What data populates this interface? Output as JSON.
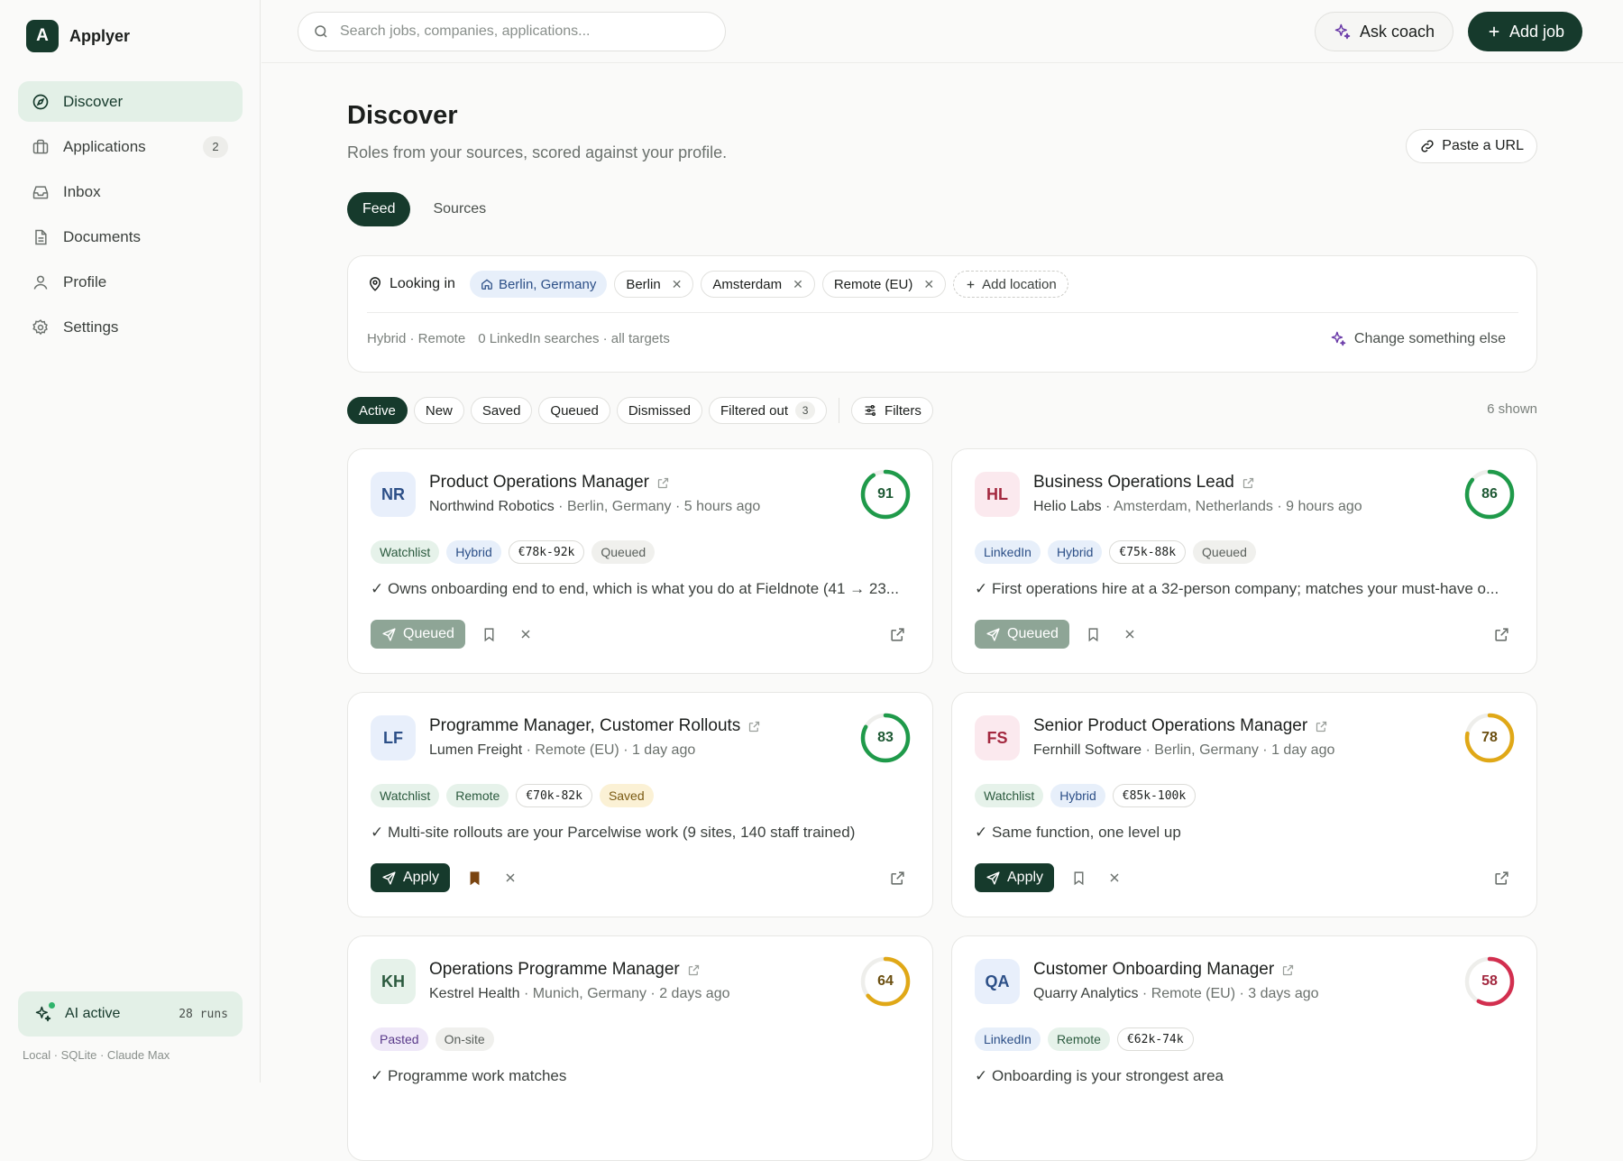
{
  "app": {
    "logo_letter": "A",
    "name": "Applyer"
  },
  "nav": [
    {
      "label": "Discover",
      "icon": "compass-icon",
      "active": true,
      "count": ""
    },
    {
      "label": "Applications",
      "icon": "briefcase-icon",
      "active": false,
      "count": "2"
    },
    {
      "label": "Inbox",
      "icon": "inbox-icon",
      "active": false,
      "count": ""
    },
    {
      "label": "Documents",
      "icon": "document-icon",
      "active": false,
      "count": ""
    },
    {
      "label": "Profile",
      "icon": "user-icon",
      "active": false,
      "count": ""
    },
    {
      "label": "Settings",
      "icon": "gear-icon",
      "active": false,
      "count": ""
    }
  ],
  "ai": {
    "label": "AI active",
    "runs": "28 runs"
  },
  "footer": "Local · SQLite · Claude Max",
  "topbar": {
    "search_placeholder": "Search jobs, companies, applications...",
    "coach_label": "Ask coach",
    "add_label": "Add job"
  },
  "page": {
    "title": "Discover",
    "subtitle": "Roles from your sources, scored against your profile.",
    "paste_label": "Paste a URL"
  },
  "tabs": [
    {
      "label": "Feed",
      "active": true
    },
    {
      "label": "Sources",
      "active": false
    }
  ],
  "locations": {
    "lead": "Looking in",
    "home": "Berlin, Germany",
    "items": [
      "Berlin",
      "Amsterdam",
      "Remote (EU)"
    ],
    "add_label": "Add location",
    "meta_work": "Hybrid · Remote",
    "meta_search": "0 LinkedIn searches · all targets",
    "change_label": "Change something else"
  },
  "filters": {
    "pills": [
      {
        "label": "Active",
        "active": true,
        "count": ""
      },
      {
        "label": "New",
        "active": false,
        "count": ""
      },
      {
        "label": "Saved",
        "active": false,
        "count": ""
      },
      {
        "label": "Queued",
        "active": false,
        "count": ""
      },
      {
        "label": "Dismissed",
        "active": false,
        "count": ""
      },
      {
        "label": "Filtered out",
        "active": false,
        "count": "3"
      }
    ],
    "filters_label": "Filters",
    "shown": "6 shown"
  },
  "colors": {
    "accent": "#163a2c",
    "score_high": "#1f9a4a",
    "score_mid": "#e0a817",
    "score_low": "#d22f4f"
  },
  "jobs": [
    {
      "initials": "NR",
      "av_bg": "#e8effb",
      "av_fg": "#2c4f87",
      "title": "Product Operations Manager",
      "company": "Northwind Robotics",
      "meta": " · Berlin, Germany · 5 hours ago",
      "score": 91,
      "score_color": "#1f9a4a",
      "tags": [
        {
          "text": "Watchlist",
          "style": "green"
        },
        {
          "text": "Hybrid",
          "style": "blue"
        },
        {
          "text": "€78k-92k",
          "style": "money"
        },
        {
          "text": "Queued",
          "style": "grey"
        }
      ],
      "reason": "✓ Owns onboarding end to end, which is what you do at Fieldnote (41 → 23...",
      "action": "Queued",
      "action_style": "queued",
      "saved": false
    },
    {
      "initials": "HL",
      "av_bg": "#fbe9ee",
      "av_fg": "#a3283f",
      "title": "Business Operations Lead",
      "company": "Helio Labs",
      "meta": " · Amsterdam, Netherlands · 9 hours ago",
      "score": 86,
      "score_color": "#1f9a4a",
      "tags": [
        {
          "text": "LinkedIn",
          "style": "blue"
        },
        {
          "text": "Hybrid",
          "style": "blue"
        },
        {
          "text": "€75k-88k",
          "style": "money"
        },
        {
          "text": "Queued",
          "style": "grey"
        }
      ],
      "reason": "✓ First operations hire at a 32-person company; matches your must-have o...",
      "action": "Queued",
      "action_style": "queued",
      "saved": false
    },
    {
      "initials": "LF",
      "av_bg": "#e8effb",
      "av_fg": "#2c4f87",
      "title": "Programme Manager, Customer Rollouts",
      "company": "Lumen Freight",
      "meta": " · Remote (EU) · 1 day ago",
      "score": 83,
      "score_color": "#1f9a4a",
      "tags": [
        {
          "text": "Watchlist",
          "style": "green"
        },
        {
          "text": "Remote",
          "style": "green"
        },
        {
          "text": "€70k-82k",
          "style": "money"
        },
        {
          "text": "Saved",
          "style": "yellow"
        }
      ],
      "reason": "✓ Multi-site rollouts are your Parcelwise work (9 sites, 140 staff trained)",
      "action": "Apply",
      "action_style": "apply",
      "saved": true
    },
    {
      "initials": "FS",
      "av_bg": "#fbe9ee",
      "av_fg": "#a3283f",
      "title": "Senior Product Operations Manager",
      "company": "Fernhill Software",
      "meta": " · Berlin, Germany · 1 day ago",
      "score": 78,
      "score_color": "#e0a817",
      "tags": [
        {
          "text": "Watchlist",
          "style": "green"
        },
        {
          "text": "Hybrid",
          "style": "blue"
        },
        {
          "text": "€85k-100k",
          "style": "money"
        }
      ],
      "reason": "✓ Same function, one level up",
      "action": "Apply",
      "action_style": "apply",
      "saved": false
    },
    {
      "initials": "KH",
      "av_bg": "#e6f2ea",
      "av_fg": "#2b5a3e",
      "title": "Operations Programme Manager",
      "company": "Kestrel Health",
      "meta": " · Munich, Germany · 2 days ago",
      "score": 64,
      "score_color": "#e0a817",
      "tags": [
        {
          "text": "Pasted",
          "style": "purple"
        },
        {
          "text": "On-site",
          "style": "grey"
        }
      ],
      "reason": "✓ Programme work matches",
      "action": "",
      "action_style": "",
      "saved": false
    },
    {
      "initials": "QA",
      "av_bg": "#e8effb",
      "av_fg": "#2c4f87",
      "title": "Customer Onboarding Manager",
      "company": "Quarry Analytics",
      "meta": " · Remote (EU) · 3 days ago",
      "score": 58,
      "score_color": "#d22f4f",
      "tags": [
        {
          "text": "LinkedIn",
          "style": "blue"
        },
        {
          "text": "Remote",
          "style": "green"
        },
        {
          "text": "€62k-74k",
          "style": "money"
        }
      ],
      "reason": "✓ Onboarding is your strongest area",
      "action": "",
      "action_style": "",
      "saved": false
    }
  ]
}
